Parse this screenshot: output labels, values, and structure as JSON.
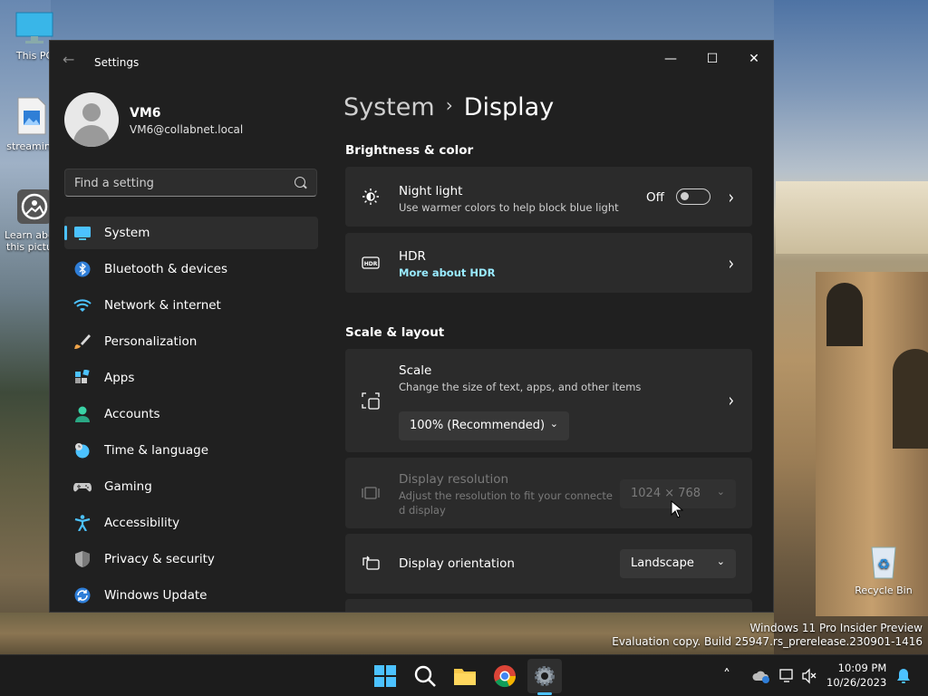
{
  "desktop": {
    "icons": [
      {
        "name": "this-pc",
        "label": "This PC"
      },
      {
        "name": "streaming",
        "label": "streaming"
      },
      {
        "name": "learn-about",
        "label": "Learn about this picture"
      },
      {
        "name": "recycle-bin",
        "label": "Recycle Bin"
      }
    ],
    "watermark_line1": "Windows 11 Pro Insider Preview",
    "watermark_line2": "Evaluation copy. Build 25947.rs_prerelease.230901-1416"
  },
  "window": {
    "title": "Settings",
    "minimize": "—",
    "maximize": "☐",
    "close": "✕"
  },
  "profile": {
    "name": "VM6",
    "email": "VM6@collabnet.local"
  },
  "search": {
    "placeholder": "Find a setting"
  },
  "sidebar": {
    "items": [
      {
        "label": "System",
        "icon": "system-icon",
        "selected": true
      },
      {
        "label": "Bluetooth & devices",
        "icon": "bluetooth-icon"
      },
      {
        "label": "Network & internet",
        "icon": "wifi-icon"
      },
      {
        "label": "Personalization",
        "icon": "brush-icon"
      },
      {
        "label": "Apps",
        "icon": "apps-icon"
      },
      {
        "label": "Accounts",
        "icon": "person-icon"
      },
      {
        "label": "Time & language",
        "icon": "clock-globe-icon"
      },
      {
        "label": "Gaming",
        "icon": "gamepad-icon"
      },
      {
        "label": "Accessibility",
        "icon": "accessibility-icon"
      },
      {
        "label": "Privacy & security",
        "icon": "shield-icon"
      },
      {
        "label": "Windows Update",
        "icon": "update-icon"
      }
    ]
  },
  "main": {
    "breadcrumb_parent": "System",
    "breadcrumb_sep": "›",
    "breadcrumb_current": "Display",
    "section1": "Brightness & color",
    "night_light": {
      "title": "Night light",
      "subtitle": "Use warmer colors to help block blue light",
      "state": "Off"
    },
    "hdr": {
      "title": "HDR",
      "link": "More about HDR"
    },
    "section2": "Scale & layout",
    "scale": {
      "title": "Scale",
      "subtitle": "Change the size of text, apps, and other items",
      "value": "100% (Recommended)"
    },
    "resolution": {
      "title": "Display resolution",
      "subtitle_line1": "Adjust the resolution to fit your connecte",
      "subtitle_line2": "d display",
      "value": "1024 × 768"
    },
    "orientation": {
      "title": "Display orientation",
      "value": "Landscape"
    }
  },
  "taskbar": {
    "time": "10:09 PM",
    "date": "10/26/2023"
  },
  "colors": {
    "accent": "#4cc2ff",
    "link": "#99ebff",
    "window_bg": "#202020",
    "card_bg": "#2b2b2b"
  }
}
